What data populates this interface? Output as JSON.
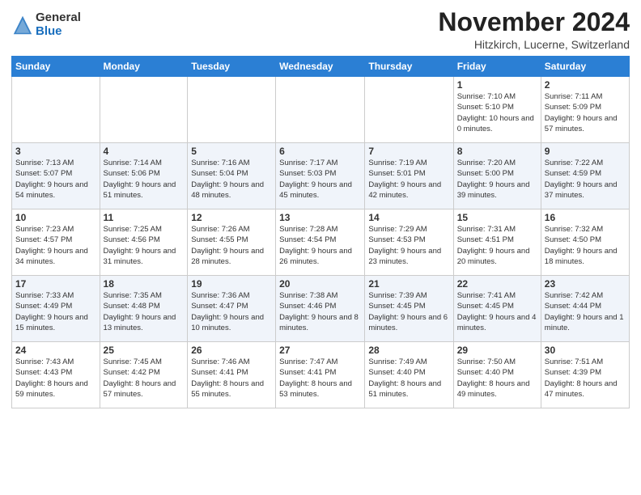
{
  "header": {
    "logo_general": "General",
    "logo_blue": "Blue",
    "month_title": "November 2024",
    "location": "Hitzkirch, Lucerne, Switzerland"
  },
  "weekdays": [
    "Sunday",
    "Monday",
    "Tuesday",
    "Wednesday",
    "Thursday",
    "Friday",
    "Saturday"
  ],
  "weeks": [
    [
      {
        "day": "",
        "info": ""
      },
      {
        "day": "",
        "info": ""
      },
      {
        "day": "",
        "info": ""
      },
      {
        "day": "",
        "info": ""
      },
      {
        "day": "",
        "info": ""
      },
      {
        "day": "1",
        "info": "Sunrise: 7:10 AM\nSunset: 5:10 PM\nDaylight: 10 hours\nand 0 minutes."
      },
      {
        "day": "2",
        "info": "Sunrise: 7:11 AM\nSunset: 5:09 PM\nDaylight: 9 hours\nand 57 minutes."
      }
    ],
    [
      {
        "day": "3",
        "info": "Sunrise: 7:13 AM\nSunset: 5:07 PM\nDaylight: 9 hours\nand 54 minutes."
      },
      {
        "day": "4",
        "info": "Sunrise: 7:14 AM\nSunset: 5:06 PM\nDaylight: 9 hours\nand 51 minutes."
      },
      {
        "day": "5",
        "info": "Sunrise: 7:16 AM\nSunset: 5:04 PM\nDaylight: 9 hours\nand 48 minutes."
      },
      {
        "day": "6",
        "info": "Sunrise: 7:17 AM\nSunset: 5:03 PM\nDaylight: 9 hours\nand 45 minutes."
      },
      {
        "day": "7",
        "info": "Sunrise: 7:19 AM\nSunset: 5:01 PM\nDaylight: 9 hours\nand 42 minutes."
      },
      {
        "day": "8",
        "info": "Sunrise: 7:20 AM\nSunset: 5:00 PM\nDaylight: 9 hours\nand 39 minutes."
      },
      {
        "day": "9",
        "info": "Sunrise: 7:22 AM\nSunset: 4:59 PM\nDaylight: 9 hours\nand 37 minutes."
      }
    ],
    [
      {
        "day": "10",
        "info": "Sunrise: 7:23 AM\nSunset: 4:57 PM\nDaylight: 9 hours\nand 34 minutes."
      },
      {
        "day": "11",
        "info": "Sunrise: 7:25 AM\nSunset: 4:56 PM\nDaylight: 9 hours\nand 31 minutes."
      },
      {
        "day": "12",
        "info": "Sunrise: 7:26 AM\nSunset: 4:55 PM\nDaylight: 9 hours\nand 28 minutes."
      },
      {
        "day": "13",
        "info": "Sunrise: 7:28 AM\nSunset: 4:54 PM\nDaylight: 9 hours\nand 26 minutes."
      },
      {
        "day": "14",
        "info": "Sunrise: 7:29 AM\nSunset: 4:53 PM\nDaylight: 9 hours\nand 23 minutes."
      },
      {
        "day": "15",
        "info": "Sunrise: 7:31 AM\nSunset: 4:51 PM\nDaylight: 9 hours\nand 20 minutes."
      },
      {
        "day": "16",
        "info": "Sunrise: 7:32 AM\nSunset: 4:50 PM\nDaylight: 9 hours\nand 18 minutes."
      }
    ],
    [
      {
        "day": "17",
        "info": "Sunrise: 7:33 AM\nSunset: 4:49 PM\nDaylight: 9 hours\nand 15 minutes."
      },
      {
        "day": "18",
        "info": "Sunrise: 7:35 AM\nSunset: 4:48 PM\nDaylight: 9 hours\nand 13 minutes."
      },
      {
        "day": "19",
        "info": "Sunrise: 7:36 AM\nSunset: 4:47 PM\nDaylight: 9 hours\nand 10 minutes."
      },
      {
        "day": "20",
        "info": "Sunrise: 7:38 AM\nSunset: 4:46 PM\nDaylight: 9 hours\nand 8 minutes."
      },
      {
        "day": "21",
        "info": "Sunrise: 7:39 AM\nSunset: 4:45 PM\nDaylight: 9 hours\nand 6 minutes."
      },
      {
        "day": "22",
        "info": "Sunrise: 7:41 AM\nSunset: 4:45 PM\nDaylight: 9 hours\nand 4 minutes."
      },
      {
        "day": "23",
        "info": "Sunrise: 7:42 AM\nSunset: 4:44 PM\nDaylight: 9 hours\nand 1 minute."
      }
    ],
    [
      {
        "day": "24",
        "info": "Sunrise: 7:43 AM\nSunset: 4:43 PM\nDaylight: 8 hours\nand 59 minutes."
      },
      {
        "day": "25",
        "info": "Sunrise: 7:45 AM\nSunset: 4:42 PM\nDaylight: 8 hours\nand 57 minutes."
      },
      {
        "day": "26",
        "info": "Sunrise: 7:46 AM\nSunset: 4:41 PM\nDaylight: 8 hours\nand 55 minutes."
      },
      {
        "day": "27",
        "info": "Sunrise: 7:47 AM\nSunset: 4:41 PM\nDaylight: 8 hours\nand 53 minutes."
      },
      {
        "day": "28",
        "info": "Sunrise: 7:49 AM\nSunset: 4:40 PM\nDaylight: 8 hours\nand 51 minutes."
      },
      {
        "day": "29",
        "info": "Sunrise: 7:50 AM\nSunset: 4:40 PM\nDaylight: 8 hours\nand 49 minutes."
      },
      {
        "day": "30",
        "info": "Sunrise: 7:51 AM\nSunset: 4:39 PM\nDaylight: 8 hours\nand 47 minutes."
      }
    ]
  ]
}
